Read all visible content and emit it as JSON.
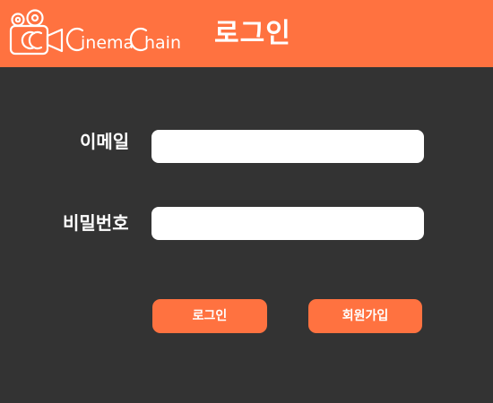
{
  "header": {
    "brand_name_c1": "C",
    "brand_name_part1": "inema",
    "brand_name_c2": "C",
    "brand_name_part2": "hain",
    "logo_icon": "film-camera-icon",
    "title": "로그인",
    "background_color": "#FF7240"
  },
  "form": {
    "email_label": "이메일",
    "email_value": "",
    "password_label": "비밀번호",
    "password_value": ""
  },
  "actions": {
    "login_label": "로그인",
    "signup_label": "회원가입",
    "button_color": "#FF7240"
  },
  "theme": {
    "background": "#333333",
    "text": "#FFFFFF"
  }
}
